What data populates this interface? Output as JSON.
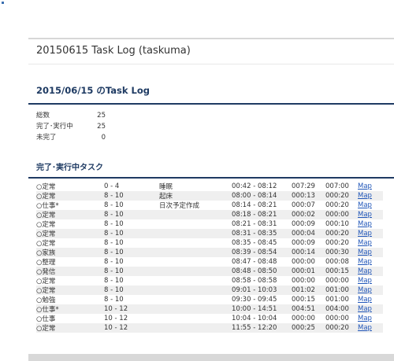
{
  "header": {
    "title": "20150615 Task Log (taskuma)"
  },
  "log": {
    "heading": "2015/06/15 のTask Log",
    "summary": [
      {
        "label": "総数",
        "value": "25"
      },
      {
        "label": "完了･実行中",
        "value": "25"
      },
      {
        "label": "未完了",
        "value": "0"
      }
    ]
  },
  "tasks": {
    "heading": "完了･実行中タスク",
    "map_label": "Map",
    "rows": [
      {
        "cat": "○定常",
        "time": "0 - 4",
        "name": "睡眠",
        "span": "00:42 - 08:12",
        "dur": "007:29",
        "est": "007:00"
      },
      {
        "cat": "○定常",
        "time": "8 - 10",
        "name": "起床",
        "span": "08:00 - 08:14",
        "dur": "000:13",
        "est": "000:20"
      },
      {
        "cat": "○仕事*",
        "time": "8 - 10",
        "name": "日次予定作成",
        "span": "08:14 - 08:21",
        "dur": "000:07",
        "est": "000:20"
      },
      {
        "cat": "○定常",
        "time": "8 - 10",
        "name": "",
        "span": "08:18 - 08:21",
        "dur": "000:02",
        "est": "000:00"
      },
      {
        "cat": "○定常",
        "time": "8 - 10",
        "name": "",
        "span": "08:21 - 08:31",
        "dur": "000:09",
        "est": "000:10"
      },
      {
        "cat": "○定常",
        "time": "8 - 10",
        "name": "",
        "span": "08:31 - 08:35",
        "dur": "000:04",
        "est": "000:20"
      },
      {
        "cat": "○定常",
        "time": "8 - 10",
        "name": "",
        "span": "08:35 - 08:45",
        "dur": "000:09",
        "est": "000:20"
      },
      {
        "cat": "○家族",
        "time": "8 - 10",
        "name": "",
        "span": "08:39 - 08:54",
        "dur": "000:14",
        "est": "000:30"
      },
      {
        "cat": "○整理",
        "time": "8 - 10",
        "name": "",
        "span": "08:47 - 08:48",
        "dur": "000:00",
        "est": "000:08"
      },
      {
        "cat": "○発信",
        "time": "8 - 10",
        "name": "",
        "span": "08:48 - 08:50",
        "dur": "000:01",
        "est": "000:15"
      },
      {
        "cat": "○定常",
        "time": "8 - 10",
        "name": "",
        "span": "08:58 - 08:58",
        "dur": "000:00",
        "est": "000:00"
      },
      {
        "cat": "○定常",
        "time": "8 - 10",
        "name": "",
        "span": "09:01 - 10:03",
        "dur": "001:02",
        "est": "001:00"
      },
      {
        "cat": "○勉強",
        "time": "8 - 10",
        "name": "",
        "span": "09:30 - 09:45",
        "dur": "000:15",
        "est": "001:00"
      },
      {
        "cat": "○仕事*",
        "time": "10 - 12",
        "name": "",
        "span": "10:00 - 14:51",
        "dur": "004:51",
        "est": "004:00"
      },
      {
        "cat": "○仕事",
        "time": "10 - 12",
        "name": "",
        "span": "10:04 - 10:04",
        "dur": "000:00",
        "est": "000:00"
      },
      {
        "cat": "○定常",
        "time": "10 - 12",
        "name": "",
        "span": "11:55 - 12:20",
        "dur": "000:25",
        "est": "000:20"
      }
    ]
  }
}
